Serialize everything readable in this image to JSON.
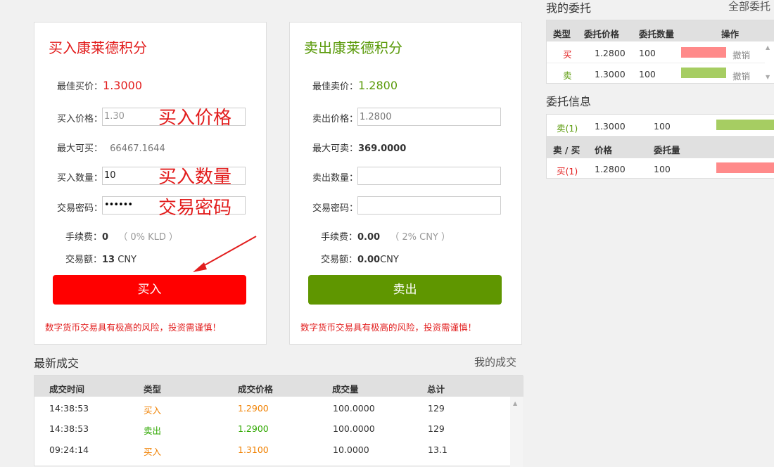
{
  "buy": {
    "title": "买入康莱德积分",
    "best_price_label": "最佳买价：",
    "best_price": "1.3000",
    "price_label": "买入价格：",
    "price_value": "1.30",
    "price_ghost": "买入价格",
    "max_label": "最大可买：",
    "max_value": "66467.1644",
    "qty_label": "买入数量：",
    "qty_value": "10",
    "qty_ghost": "买入数量",
    "pwd_label": "交易密码：",
    "pwd_value": "••••••",
    "pwd_ghost": "交易密码",
    "fee_label": "手续费：",
    "fee_value": "0",
    "fee_note": "（ 0% KLD ）",
    "amount_label": "交易额：",
    "amount_value": "13",
    "amount_unit": " CNY",
    "button": "买入",
    "warning": "数字货币交易具有极高的风险，投资需谨慎！"
  },
  "sell": {
    "title": "卖出康莱德积分",
    "best_price_label": "最佳卖价：",
    "best_price": "1.2800",
    "price_label": "卖出价格：",
    "price_placeholder": "1.2800",
    "max_label": "最大可卖：",
    "max_value": "369.0000",
    "qty_label": "卖出数量：",
    "pwd_label": "交易密码：",
    "fee_label": "手续费：",
    "fee_value": "0.00",
    "fee_note": "（ 2% CNY ）",
    "amount_label": "交易额：",
    "amount_value": "0.00",
    "amount_unit": "CNY",
    "button": "卖出",
    "warning": "数字货币交易具有极高的风险，投资需谨慎！"
  },
  "my_orders": {
    "title": "我的委托",
    "all_link": "全部委托",
    "headers": [
      "类型",
      "委托价格",
      "委托数量",
      "操作"
    ],
    "rows": [
      {
        "type": "买",
        "price": "1.2800",
        "qty": "100",
        "action": "撤销",
        "bar_color": "#ff8a8a"
      },
      {
        "type": "卖",
        "price": "1.3000",
        "qty": "100",
        "action": "撤销",
        "bar_color": "#a6cd62"
      }
    ]
  },
  "order_info": {
    "title": "委托信息",
    "sell_rows": [
      {
        "label": "卖(1)",
        "price": "1.3000",
        "qty": "100"
      }
    ],
    "headers": [
      "卖 / 买",
      "价格",
      "委托量"
    ],
    "buy_rows": [
      {
        "label": "买(1)",
        "price": "1.2800",
        "qty": "100"
      }
    ]
  },
  "trades": {
    "title": "最新成交",
    "my_link": "我的成交",
    "headers": [
      "成交时间",
      "类型",
      "成交价格",
      "成交量",
      "总计"
    ],
    "rows": [
      {
        "time": "14:38:53",
        "type": "买入",
        "price": "1.2900",
        "qty": "100.0000",
        "total": "129",
        "kind": "buy"
      },
      {
        "time": "14:38:53",
        "type": "卖出",
        "price": "1.2900",
        "qty": "100.0000",
        "total": "129",
        "kind": "sell"
      },
      {
        "time": "09:24:14",
        "type": "买入",
        "price": "1.3100",
        "qty": "10.0000",
        "total": "13.1",
        "kind": "buy"
      }
    ]
  },
  "colors": {
    "buy_accent": "#e21d1d",
    "sell_accent": "#5a9a0a",
    "buy_button": "#ff0000",
    "sell_button": "#5f9600"
  },
  "icons": [
    "arrow-annotation-icon",
    "scroll-up-icon",
    "scroll-down-icon"
  ]
}
